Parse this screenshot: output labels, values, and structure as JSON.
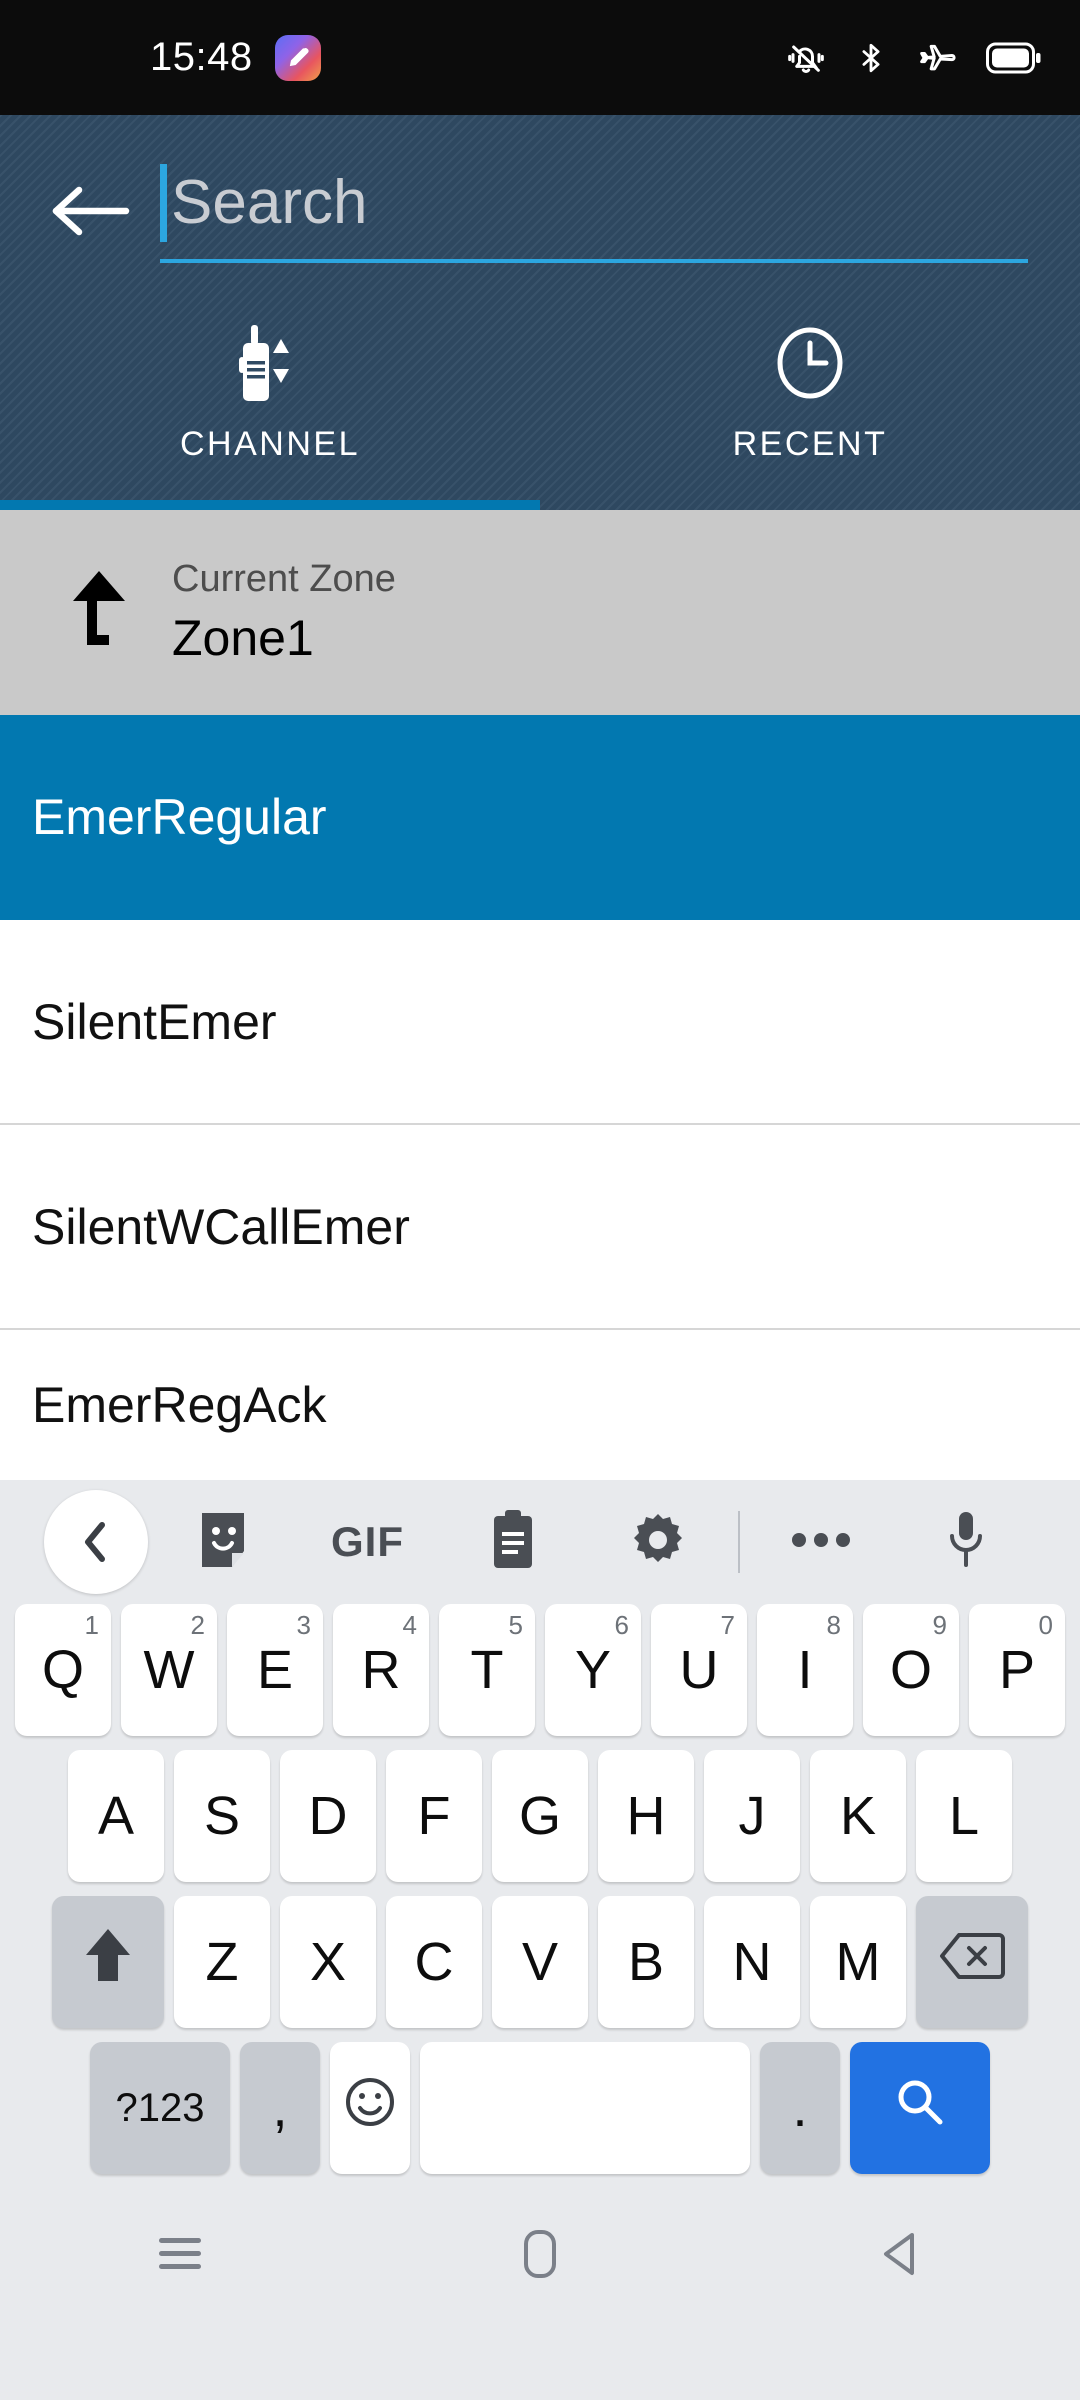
{
  "statusbar": {
    "time": "15:48",
    "app_icon": "paint-app-icon",
    "icons": [
      "vibrate-icon",
      "bluetooth-icon",
      "airplane-mode-icon",
      "battery-icon"
    ]
  },
  "header": {
    "back_icon": "back-arrow-icon",
    "search": {
      "value": "",
      "placeholder": "Search",
      "accent_color": "#2ca6e0"
    },
    "background_color": "#2f4a63",
    "tabs": [
      {
        "label": "CHANNEL",
        "icon": "walkie-talkie-icon",
        "selected": true
      },
      {
        "label": "RECENT",
        "icon": "clock-icon",
        "selected": false
      }
    ],
    "tab_indicator_color": "#0278b0"
  },
  "zone": {
    "icon": "level-up-arrow-icon",
    "caption": "Current Zone",
    "value": "Zone1",
    "background_color": "#c9c9c9"
  },
  "channel_list": {
    "selected_color": "#0278b0",
    "items": [
      {
        "label": "EmerRegular",
        "selected": true
      },
      {
        "label": "SilentEmer",
        "selected": false
      },
      {
        "label": "SilentWCallEmer",
        "selected": false
      },
      {
        "label": "EmerRegAck",
        "selected": false
      }
    ]
  },
  "keyboard": {
    "toolbar": [
      {
        "name": "back-chevron",
        "icon": "chevron-left-icon"
      },
      {
        "name": "sticker",
        "icon": "sticker-icon"
      },
      {
        "name": "gif",
        "icon": "gif-icon",
        "label": "GIF"
      },
      {
        "name": "clipboard",
        "icon": "clipboard-icon"
      },
      {
        "name": "settings",
        "icon": "gear-icon"
      },
      {
        "name": "more",
        "icon": "more-dots-icon"
      },
      {
        "name": "voice",
        "icon": "microphone-icon"
      }
    ],
    "row1": [
      {
        "key": "Q",
        "num": "1"
      },
      {
        "key": "W",
        "num": "2"
      },
      {
        "key": "E",
        "num": "3"
      },
      {
        "key": "R",
        "num": "4"
      },
      {
        "key": "T",
        "num": "5"
      },
      {
        "key": "Y",
        "num": "6"
      },
      {
        "key": "U",
        "num": "7"
      },
      {
        "key": "I",
        "num": "8"
      },
      {
        "key": "O",
        "num": "9"
      },
      {
        "key": "P",
        "num": "0"
      }
    ],
    "row2": [
      "A",
      "S",
      "D",
      "F",
      "G",
      "H",
      "J",
      "K",
      "L"
    ],
    "row3_letters": [
      "Z",
      "X",
      "C",
      "V",
      "B",
      "N",
      "M"
    ],
    "shift_icon": "shift-up-arrow-icon",
    "backspace_icon": "backspace-icon",
    "symbols_key": "?123",
    "comma_key": ",",
    "emoji_icon": "emoji-smiley-icon",
    "space_key": "",
    "period_key": ".",
    "enter_icon": "search-magnifier-icon",
    "enter_color": "#2272e2"
  },
  "navbar": {
    "recents_icon": "menu-lines-icon",
    "home_icon": "home-rounded-square-icon",
    "back_icon": "back-triangle-icon"
  }
}
